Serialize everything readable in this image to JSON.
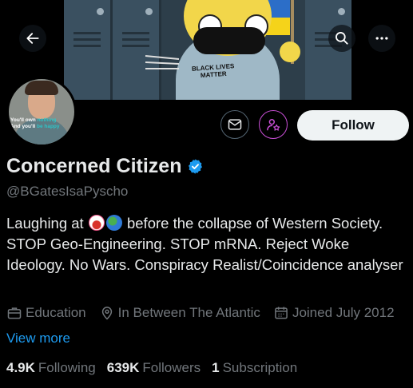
{
  "header": {
    "back_icon": "arrow-left-icon",
    "search_icon": "search-icon",
    "more_icon": "more-horizontal-icon",
    "banner_sign_text": "BLACK LIVES MATTER"
  },
  "avatar": {
    "caption_line1_a": "You'll own ",
    "caption_line1_b": "nothing",
    "caption_line2_a": "And you'll ",
    "caption_line2_b": "be happy"
  },
  "actions": {
    "message_icon": "mail-icon",
    "subscribe_icon": "person-star-icon",
    "follow_label": "Follow"
  },
  "profile": {
    "display_name": "Concerned Citizen",
    "verified_icon": "verified-badge-icon",
    "handle": "@BGatesIsaPyscho",
    "bio_prefix": "Laughing at",
    "bio_rest": "before the collapse of Western Society. STOP Geo-Engineering. STOP mRNA. Reject Woke Ideology. No Wars. Conspiracy Realist/Coincidence analyser",
    "bio_emojis": [
      "clown-emoji",
      "globe-emoji"
    ],
    "category": "Education",
    "location": "In Between The Atlantic",
    "joined": "Joined July 2012",
    "view_more": "View more"
  },
  "stats": {
    "following_count": "4.9K",
    "following_label": "Following",
    "followers_count": "639K",
    "followers_label": "Followers",
    "subscriptions_count": "1",
    "subscriptions_label": "Subscription"
  },
  "colors": {
    "background": "#000000",
    "accent": "#1d9bf0",
    "subscribe_accent": "#c94fd6",
    "muted_text": "#71767b"
  }
}
